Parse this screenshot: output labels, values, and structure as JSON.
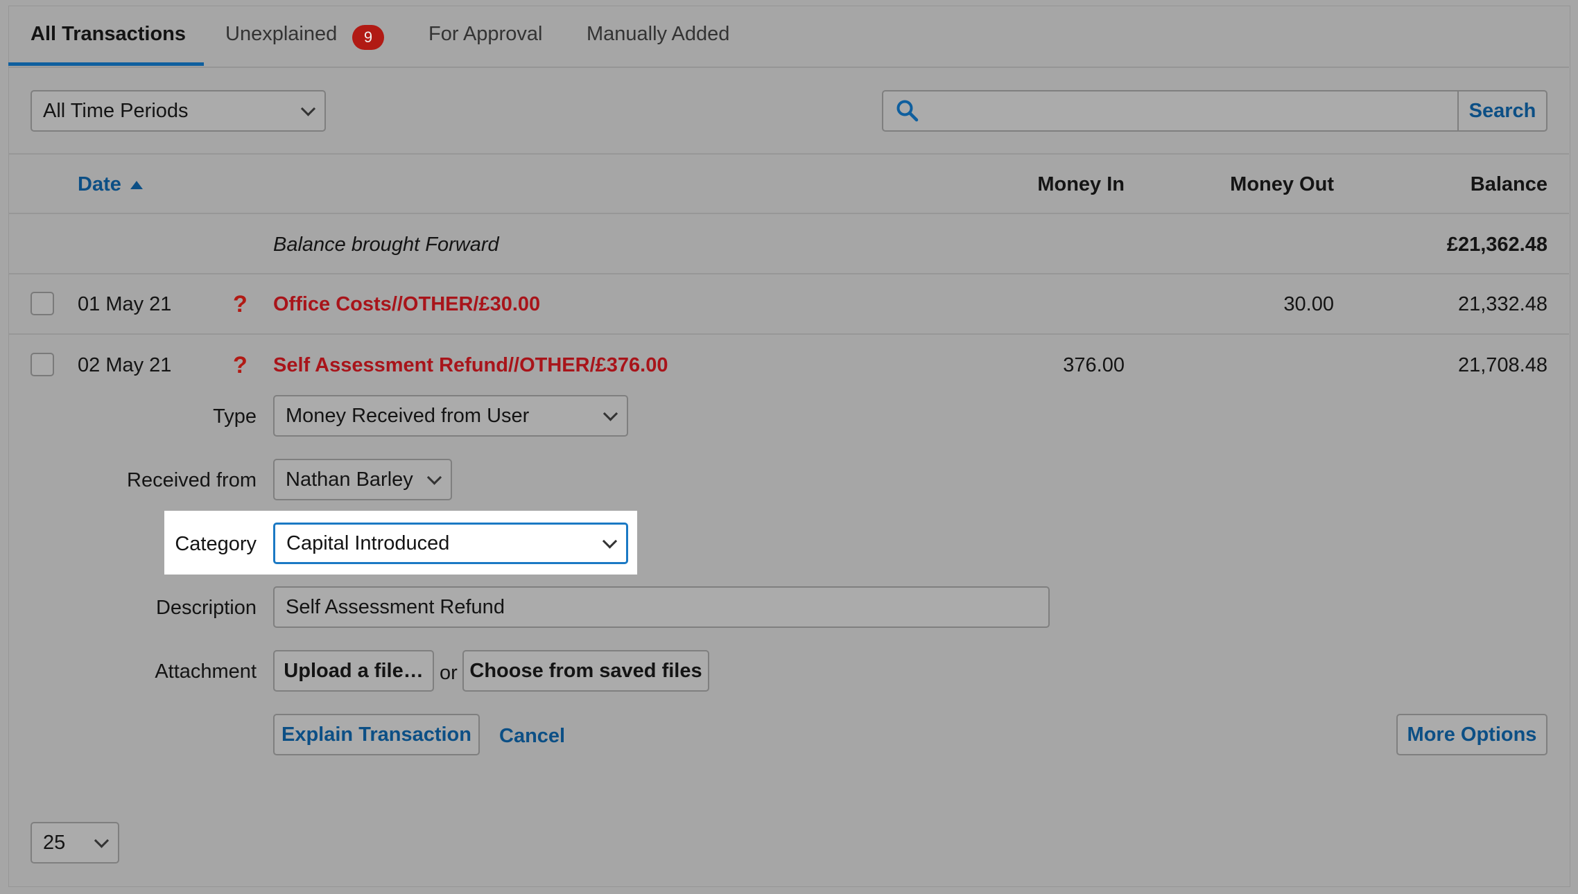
{
  "tabs": [
    {
      "label": "All Transactions"
    },
    {
      "label": "Unexplained",
      "badge": "9"
    },
    {
      "label": "For Approval"
    },
    {
      "label": "Manually Added"
    }
  ],
  "filters": {
    "period": "All Time Periods",
    "search_value": "",
    "search_button": "Search"
  },
  "table": {
    "headers": {
      "date": "Date",
      "money_in": "Money In",
      "money_out": "Money Out",
      "balance": "Balance"
    },
    "brought_forward": {
      "label": "Balance brought Forward",
      "balance": "£21,362.48"
    },
    "rows": [
      {
        "date": "01 May 21",
        "description": "Office Costs//OTHER/£30.00",
        "money_in": "",
        "money_out": "30.00",
        "balance": "21,332.48"
      },
      {
        "date": "02 May 21",
        "description": "Self Assessment Refund//OTHER/£376.00",
        "money_in": "376.00",
        "money_out": "",
        "balance": "21,708.48"
      }
    ]
  },
  "form": {
    "type_label": "Type",
    "type_value": "Money Received from User",
    "received_from_label": "Received from",
    "received_from_value": "Nathan Barley",
    "category_label": "Category",
    "category_value": "Capital Introduced",
    "description_label": "Description",
    "description_value": "Self Assessment Refund",
    "attachment_label": "Attachment",
    "upload_button": "Upload a file…",
    "or_text": "or",
    "choose_button": "Choose from saved files",
    "explain_button": "Explain Transaction",
    "cancel_link": "Cancel",
    "more_options_button": "More Options"
  },
  "pagination": {
    "per_page": "25"
  },
  "colors": {
    "accent": "#0f5f9e",
    "unexplained": "#a8141a",
    "badge": "#b11a14"
  }
}
